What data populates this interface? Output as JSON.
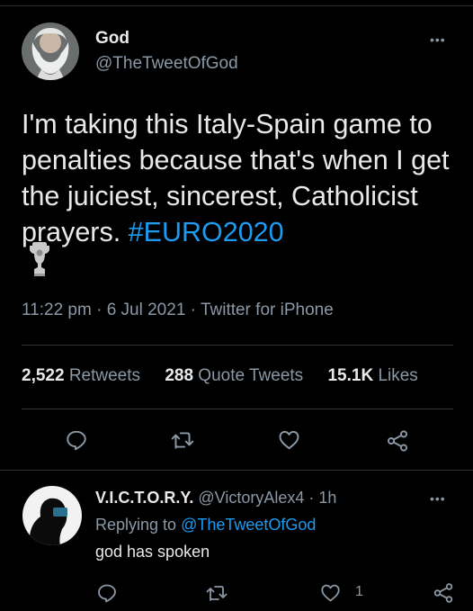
{
  "tweet": {
    "author_name": "God",
    "author_handle": "@TheTweetOfGod",
    "more_label": "•••",
    "text": "I'm taking this Italy-Spain game to penalties because that's when I get the juiciest, sincerest, Catholicist prayers. ",
    "hashtag": "#EURO2020",
    "time": "11:22 pm",
    "date": "6 Jul 2021",
    "source": "Twitter for iPhone",
    "separator": "·",
    "stats": {
      "retweets_count": "2,522",
      "retweets_label": "Retweets",
      "quotes_count": "288",
      "quotes_label": "Quote Tweets",
      "likes_count": "15.1K",
      "likes_label": "Likes"
    }
  },
  "reply": {
    "author_name": "V.I.C.T.O.R.Y.",
    "author_handle": "@VictoryAlex4",
    "time": "1h",
    "separator": "·",
    "more_label": "•••",
    "replying_prefix": "Replying to",
    "replying_to": "@TheTweetOfGod",
    "text": "god has spoken",
    "like_count": "1"
  },
  "colors": {
    "background": "#000000",
    "text": "#e7e9ea",
    "secondary": "#8b98a5",
    "link": "#1d9bf0",
    "divider": "#2f3336"
  },
  "icons": [
    "reply-icon",
    "retweet-icon",
    "like-icon",
    "share-icon",
    "trophy-icon",
    "more-icon"
  ]
}
